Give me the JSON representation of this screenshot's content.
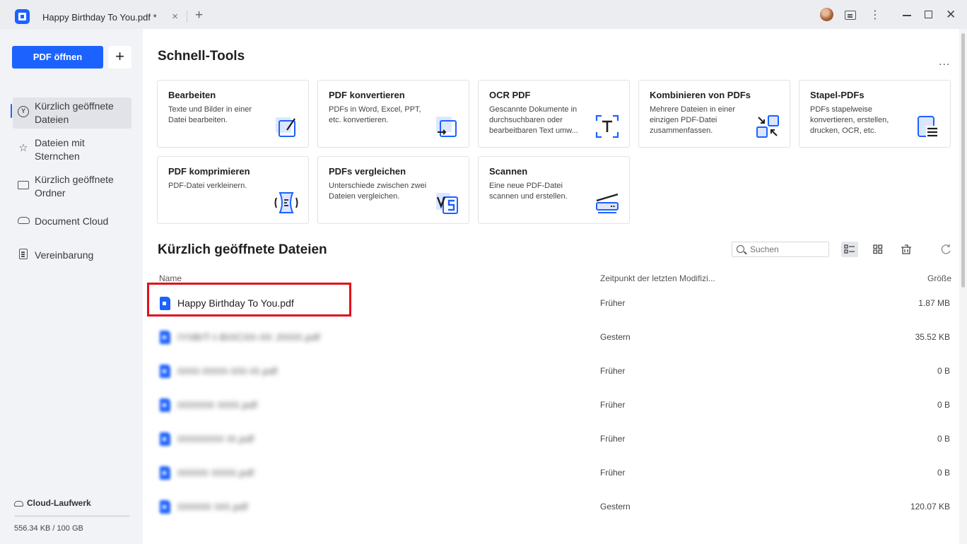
{
  "window": {
    "tab_title": "Happy Birthday To You.pdf *",
    "tab_close": "×",
    "new_tab": "+",
    "more": "⋮",
    "close": "✕"
  },
  "sidebar": {
    "open_pdf": "PDF öffnen",
    "add": "+",
    "items": [
      {
        "label": "Kürzlich geöffnete Dateien",
        "icon": "recent-icon",
        "active": true
      },
      {
        "label": "Dateien mit Sternchen",
        "icon": "star-icon"
      },
      {
        "label": "Kürzlich geöffnete Ordner",
        "icon": "folder-icon"
      },
      {
        "label": "Document Cloud",
        "icon": "cloud-icon"
      },
      {
        "label": "Vereinbarung",
        "icon": "document-icon"
      }
    ],
    "cloud_drive": "Cloud-Laufwerk",
    "cloud_usage": "556.34 KB / 100 GB",
    "cloud_fill_fraction": 5e-06
  },
  "quick_tools": {
    "title": "Schnell-Tools",
    "more": "...",
    "cards": [
      {
        "title": "Bearbeiten",
        "desc": "Texte und Bilder in einer Datei bearbeiten."
      },
      {
        "title": "PDF konvertieren",
        "desc": "PDFs in Word, Excel, PPT, etc. konvertieren."
      },
      {
        "title": "OCR PDF",
        "desc": "Gescannte Dokumente in durchsuchbaren oder bearbeitbaren Text umw..."
      },
      {
        "title": "Kombinieren von PDFs",
        "desc": "Mehrere Dateien in einer einzigen PDF-Datei zusammenfassen."
      },
      {
        "title": "Stapel-PDFs",
        "desc": "PDFs stapelweise konvertieren, erstellen, drucken, OCR, etc."
      },
      {
        "title": "PDF komprimieren",
        "desc": "PDF-Datei verkleinern."
      },
      {
        "title": "PDFs vergleichen",
        "desc": "Unterschiede zwischen zwei Dateien vergleichen."
      },
      {
        "title": "Scannen",
        "desc": "Eine neue PDF-Datei scannen und erstellen."
      }
    ]
  },
  "recent": {
    "title": "Kürzlich geöffnete Dateien",
    "search_placeholder": "Suchen",
    "columns": {
      "name": "Name",
      "modified": "Zeitpunkt der letzten Modifizi...",
      "size": "Größe"
    },
    "files": [
      {
        "name": "Happy Birthday To You.pdf",
        "modified": "Früher",
        "size": "1.87 MB"
      },
      {
        "name": "IYIIBIT-I-BIIICIIII-IIII JIIIIIII.pdf",
        "modified": "Gestern",
        "size": "35.52 KB"
      },
      {
        "name": "IIIIIII-IIIIIIII-IIIII-III.pdf",
        "modified": "Früher",
        "size": "0 B"
      },
      {
        "name": "IIIIIIIIIIII IIIIIII.pdf",
        "modified": "Früher",
        "size": "0 B"
      },
      {
        "name": "IIIIIIIIIIIIIII III.pdf",
        "modified": "Früher",
        "size": "0 B"
      },
      {
        "name": "IIIIIIIIII IIIIIIII.pdf",
        "modified": "Früher",
        "size": "0 B"
      },
      {
        "name": "IIIIIIIIIII IIIII.pdf",
        "modified": "Gestern",
        "size": "120.07 KB"
      }
    ]
  }
}
